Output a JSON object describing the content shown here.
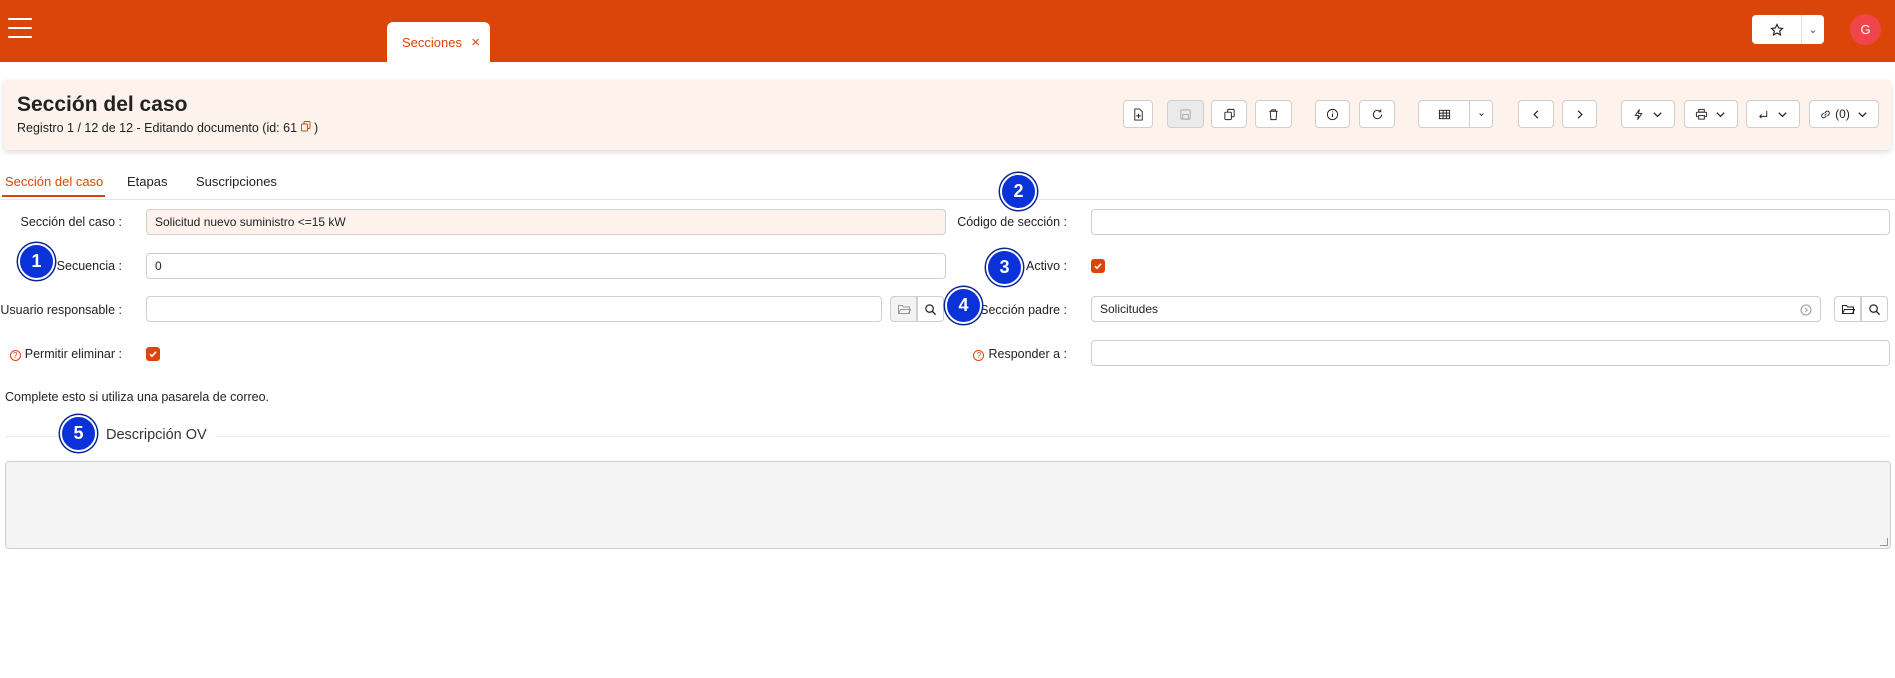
{
  "colors": {
    "brand": "#dc4509",
    "badge": "#0a32d8",
    "avatar": "#f0454a"
  },
  "topbar": {
    "tab_label": "Secciones",
    "tab_close": "×",
    "avatar_initial": "G",
    "favorites_caret": "⌄"
  },
  "header": {
    "title": "Sección del caso",
    "subtitle": "Registro 1 / 12 de 12 - Editando documento (id: 61 ",
    "subtitle_end": ")",
    "links_count": "(0)",
    "toolbar_icons": [
      "new-document-icon",
      "save-icon",
      "copy-icon",
      "delete-icon",
      "info-icon",
      "refresh-icon",
      "grid-view-icon",
      "dropdown-caret-icon",
      "previous-icon",
      "next-icon",
      "process-icon",
      "print-icon",
      "report-icon",
      "link-icon"
    ]
  },
  "tabs": [
    "Sección del caso",
    "Etapas",
    "Suscripciones"
  ],
  "form": {
    "seccion_label": "Sección del caso :",
    "seccion_value": "Solicitud nuevo suministro <=15 kW",
    "codigo_label": "Código de sección :",
    "codigo_value": "",
    "secuencia_label": "Secuencia :",
    "secuencia_value": "0",
    "activo_label": "Activo :",
    "activo_checked": true,
    "usuario_label": "Usuario responsable :",
    "usuario_value": "",
    "padre_label": "Sección padre :",
    "padre_value": "Solicitudes",
    "permitir_label": "Permitir eliminar :",
    "permitir_checked": true,
    "responder_label": "Responder a :",
    "responder_value": "",
    "help_glyph": "?"
  },
  "note": "Complete esto si utiliza una pasarela de correo.",
  "descripcion": {
    "title": "Descripción OV",
    "value": ""
  },
  "badges": [
    "1",
    "2",
    "3",
    "4",
    "5"
  ]
}
